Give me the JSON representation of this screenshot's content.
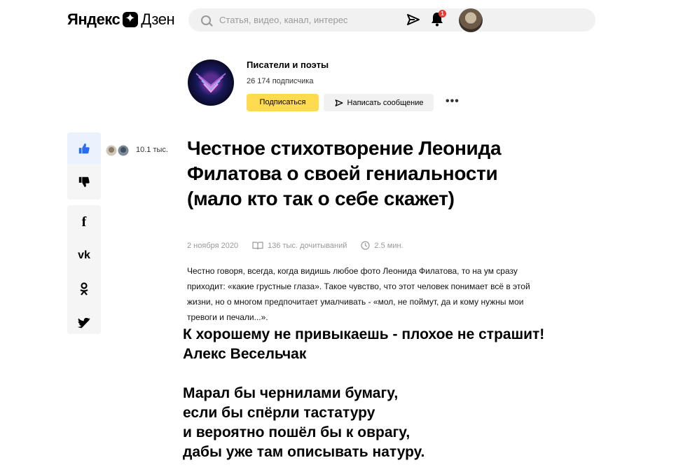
{
  "header": {
    "logo_part1": "Яндекс",
    "logo_part2": "Дзен",
    "search_placeholder": "Статья, видео, канал, интерес",
    "notification_count": "1"
  },
  "channel": {
    "name": "Писатели и поэты",
    "subscribers": "26 174 подписчика",
    "subscribe_label": "Подписаться",
    "message_label": "Написать сообщение",
    "more_label": "•••"
  },
  "reactions": {
    "likes_count": "10.1 тыс."
  },
  "share": {
    "icons": [
      "facebook-icon",
      "vk-icon",
      "odnoklassniki-icon",
      "twitter-icon"
    ]
  },
  "article": {
    "title": "Честное стихотворение Леонида Филатова о своей гениальности (мало кто так о себе скажет)",
    "date": "2 ноября 2020",
    "reads": "136 тыс. дочитываний",
    "read_time": "2.5 мин.",
    "lead": "Честно говоря, всегда, когда видишь любое фото Леонида Филатова, то на ум сразу приходит: «какие грустные глаза». Такое чувство, что этот человек понимает всё в этой жизни, но о многом предпочитает умалчивать - «мол, не поймут, да и кому нужны мои тревоги и печали...».",
    "overlay_text": "К хорошему не привыкаешь - плохое не страшит!\nАлекс Весельчак\n\nМарал бы чернилами бумагу,\nесли бы спёрли тастатуру\nи вероятно пошёл бы к оврагу,\nдабы уже там описывать натуру."
  },
  "colors": {
    "accent_yellow": "#ffdb4d",
    "like_blue": "#2a6df4",
    "badge_red": "#e53935"
  }
}
